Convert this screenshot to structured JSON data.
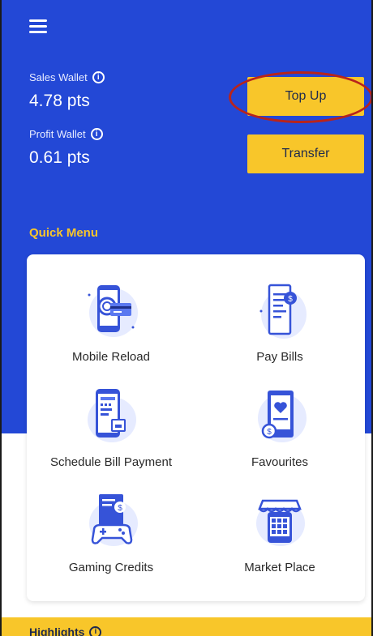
{
  "header": {
    "menu_icon": "hamburger-menu-icon",
    "sales_wallet": {
      "label": "Sales Wallet",
      "value": "4.78 pts"
    },
    "profit_wallet": {
      "label": "Profit Wallet",
      "value": "0.61 pts"
    },
    "top_up_label": "Top Up",
    "transfer_label": "Transfer"
  },
  "quick_menu": {
    "title": "Quick Menu",
    "items": [
      {
        "label": "Mobile Reload",
        "icon": "mobile-reload-icon"
      },
      {
        "label": "Pay Bills",
        "icon": "pay-bills-icon"
      },
      {
        "label": "Schedule Bill Payment",
        "icon": "schedule-bill-payment-icon"
      },
      {
        "label": "Favourites",
        "icon": "favourites-icon"
      },
      {
        "label": "Gaming Credits",
        "icon": "gaming-credits-icon"
      },
      {
        "label": "Market Place",
        "icon": "market-place-icon"
      }
    ]
  },
  "highlights": {
    "label": "Highlights"
  },
  "colors": {
    "brand_blue": "#2348d6",
    "accent_yellow": "#f8c62a",
    "annotation_red": "#b8241c"
  }
}
